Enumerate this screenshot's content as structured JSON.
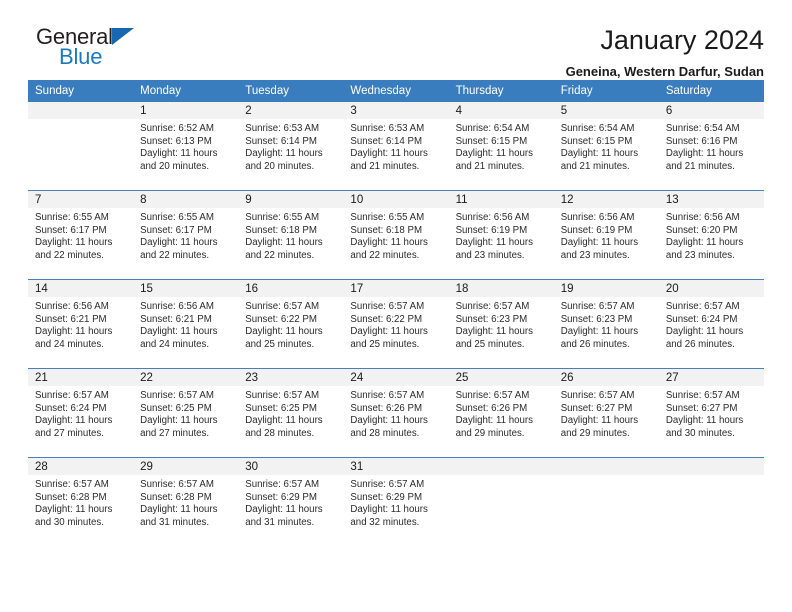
{
  "brand": {
    "name_top": "General",
    "name_bottom": "Blue",
    "accent_color": "#1668b3",
    "text_color": "#231f20",
    "blue_text_color": "#1b79c4"
  },
  "header": {
    "title": "January 2024",
    "subtitle": "Geneina, Western Darfur, Sudan"
  },
  "calendar": {
    "header_background": "#3a7dbf",
    "header_text_color": "#ffffff",
    "daynum_background": "#f2f2f2",
    "grid_line_color": "#4a7ebb",
    "weekday_headers": [
      "Sunday",
      "Monday",
      "Tuesday",
      "Wednesday",
      "Thursday",
      "Friday",
      "Saturday"
    ],
    "weeks": [
      [
        {
          "day": "",
          "sunrise": "",
          "sunset": "",
          "daylight_line1": "",
          "daylight_line2": ""
        },
        {
          "day": "1",
          "sunrise": "Sunrise: 6:52 AM",
          "sunset": "Sunset: 6:13 PM",
          "daylight_line1": "Daylight: 11 hours",
          "daylight_line2": "and 20 minutes."
        },
        {
          "day": "2",
          "sunrise": "Sunrise: 6:53 AM",
          "sunset": "Sunset: 6:14 PM",
          "daylight_line1": "Daylight: 11 hours",
          "daylight_line2": "and 20 minutes."
        },
        {
          "day": "3",
          "sunrise": "Sunrise: 6:53 AM",
          "sunset": "Sunset: 6:14 PM",
          "daylight_line1": "Daylight: 11 hours",
          "daylight_line2": "and 21 minutes."
        },
        {
          "day": "4",
          "sunrise": "Sunrise: 6:54 AM",
          "sunset": "Sunset: 6:15 PM",
          "daylight_line1": "Daylight: 11 hours",
          "daylight_line2": "and 21 minutes."
        },
        {
          "day": "5",
          "sunrise": "Sunrise: 6:54 AM",
          "sunset": "Sunset: 6:15 PM",
          "daylight_line1": "Daylight: 11 hours",
          "daylight_line2": "and 21 minutes."
        },
        {
          "day": "6",
          "sunrise": "Sunrise: 6:54 AM",
          "sunset": "Sunset: 6:16 PM",
          "daylight_line1": "Daylight: 11 hours",
          "daylight_line2": "and 21 minutes."
        }
      ],
      [
        {
          "day": "7",
          "sunrise": "Sunrise: 6:55 AM",
          "sunset": "Sunset: 6:17 PM",
          "daylight_line1": "Daylight: 11 hours",
          "daylight_line2": "and 22 minutes."
        },
        {
          "day": "8",
          "sunrise": "Sunrise: 6:55 AM",
          "sunset": "Sunset: 6:17 PM",
          "daylight_line1": "Daylight: 11 hours",
          "daylight_line2": "and 22 minutes."
        },
        {
          "day": "9",
          "sunrise": "Sunrise: 6:55 AM",
          "sunset": "Sunset: 6:18 PM",
          "daylight_line1": "Daylight: 11 hours",
          "daylight_line2": "and 22 minutes."
        },
        {
          "day": "10",
          "sunrise": "Sunrise: 6:55 AM",
          "sunset": "Sunset: 6:18 PM",
          "daylight_line1": "Daylight: 11 hours",
          "daylight_line2": "and 22 minutes."
        },
        {
          "day": "11",
          "sunrise": "Sunrise: 6:56 AM",
          "sunset": "Sunset: 6:19 PM",
          "daylight_line1": "Daylight: 11 hours",
          "daylight_line2": "and 23 minutes."
        },
        {
          "day": "12",
          "sunrise": "Sunrise: 6:56 AM",
          "sunset": "Sunset: 6:19 PM",
          "daylight_line1": "Daylight: 11 hours",
          "daylight_line2": "and 23 minutes."
        },
        {
          "day": "13",
          "sunrise": "Sunrise: 6:56 AM",
          "sunset": "Sunset: 6:20 PM",
          "daylight_line1": "Daylight: 11 hours",
          "daylight_line2": "and 23 minutes."
        }
      ],
      [
        {
          "day": "14",
          "sunrise": "Sunrise: 6:56 AM",
          "sunset": "Sunset: 6:21 PM",
          "daylight_line1": "Daylight: 11 hours",
          "daylight_line2": "and 24 minutes."
        },
        {
          "day": "15",
          "sunrise": "Sunrise: 6:56 AM",
          "sunset": "Sunset: 6:21 PM",
          "daylight_line1": "Daylight: 11 hours",
          "daylight_line2": "and 24 minutes."
        },
        {
          "day": "16",
          "sunrise": "Sunrise: 6:57 AM",
          "sunset": "Sunset: 6:22 PM",
          "daylight_line1": "Daylight: 11 hours",
          "daylight_line2": "and 25 minutes."
        },
        {
          "day": "17",
          "sunrise": "Sunrise: 6:57 AM",
          "sunset": "Sunset: 6:22 PM",
          "daylight_line1": "Daylight: 11 hours",
          "daylight_line2": "and 25 minutes."
        },
        {
          "day": "18",
          "sunrise": "Sunrise: 6:57 AM",
          "sunset": "Sunset: 6:23 PM",
          "daylight_line1": "Daylight: 11 hours",
          "daylight_line2": "and 25 minutes."
        },
        {
          "day": "19",
          "sunrise": "Sunrise: 6:57 AM",
          "sunset": "Sunset: 6:23 PM",
          "daylight_line1": "Daylight: 11 hours",
          "daylight_line2": "and 26 minutes."
        },
        {
          "day": "20",
          "sunrise": "Sunrise: 6:57 AM",
          "sunset": "Sunset: 6:24 PM",
          "daylight_line1": "Daylight: 11 hours",
          "daylight_line2": "and 26 minutes."
        }
      ],
      [
        {
          "day": "21",
          "sunrise": "Sunrise: 6:57 AM",
          "sunset": "Sunset: 6:24 PM",
          "daylight_line1": "Daylight: 11 hours",
          "daylight_line2": "and 27 minutes."
        },
        {
          "day": "22",
          "sunrise": "Sunrise: 6:57 AM",
          "sunset": "Sunset: 6:25 PM",
          "daylight_line1": "Daylight: 11 hours",
          "daylight_line2": "and 27 minutes."
        },
        {
          "day": "23",
          "sunrise": "Sunrise: 6:57 AM",
          "sunset": "Sunset: 6:25 PM",
          "daylight_line1": "Daylight: 11 hours",
          "daylight_line2": "and 28 minutes."
        },
        {
          "day": "24",
          "sunrise": "Sunrise: 6:57 AM",
          "sunset": "Sunset: 6:26 PM",
          "daylight_line1": "Daylight: 11 hours",
          "daylight_line2": "and 28 minutes."
        },
        {
          "day": "25",
          "sunrise": "Sunrise: 6:57 AM",
          "sunset": "Sunset: 6:26 PM",
          "daylight_line1": "Daylight: 11 hours",
          "daylight_line2": "and 29 minutes."
        },
        {
          "day": "26",
          "sunrise": "Sunrise: 6:57 AM",
          "sunset": "Sunset: 6:27 PM",
          "daylight_line1": "Daylight: 11 hours",
          "daylight_line2": "and 29 minutes."
        },
        {
          "day": "27",
          "sunrise": "Sunrise: 6:57 AM",
          "sunset": "Sunset: 6:27 PM",
          "daylight_line1": "Daylight: 11 hours",
          "daylight_line2": "and 30 minutes."
        }
      ],
      [
        {
          "day": "28",
          "sunrise": "Sunrise: 6:57 AM",
          "sunset": "Sunset: 6:28 PM",
          "daylight_line1": "Daylight: 11 hours",
          "daylight_line2": "and 30 minutes."
        },
        {
          "day": "29",
          "sunrise": "Sunrise: 6:57 AM",
          "sunset": "Sunset: 6:28 PM",
          "daylight_line1": "Daylight: 11 hours",
          "daylight_line2": "and 31 minutes."
        },
        {
          "day": "30",
          "sunrise": "Sunrise: 6:57 AM",
          "sunset": "Sunset: 6:29 PM",
          "daylight_line1": "Daylight: 11 hours",
          "daylight_line2": "and 31 minutes."
        },
        {
          "day": "31",
          "sunrise": "Sunrise: 6:57 AM",
          "sunset": "Sunset: 6:29 PM",
          "daylight_line1": "Daylight: 11 hours",
          "daylight_line2": "and 32 minutes."
        },
        {
          "day": "",
          "sunrise": "",
          "sunset": "",
          "daylight_line1": "",
          "daylight_line2": ""
        },
        {
          "day": "",
          "sunrise": "",
          "sunset": "",
          "daylight_line1": "",
          "daylight_line2": ""
        },
        {
          "day": "",
          "sunrise": "",
          "sunset": "",
          "daylight_line1": "",
          "daylight_line2": ""
        }
      ]
    ]
  }
}
